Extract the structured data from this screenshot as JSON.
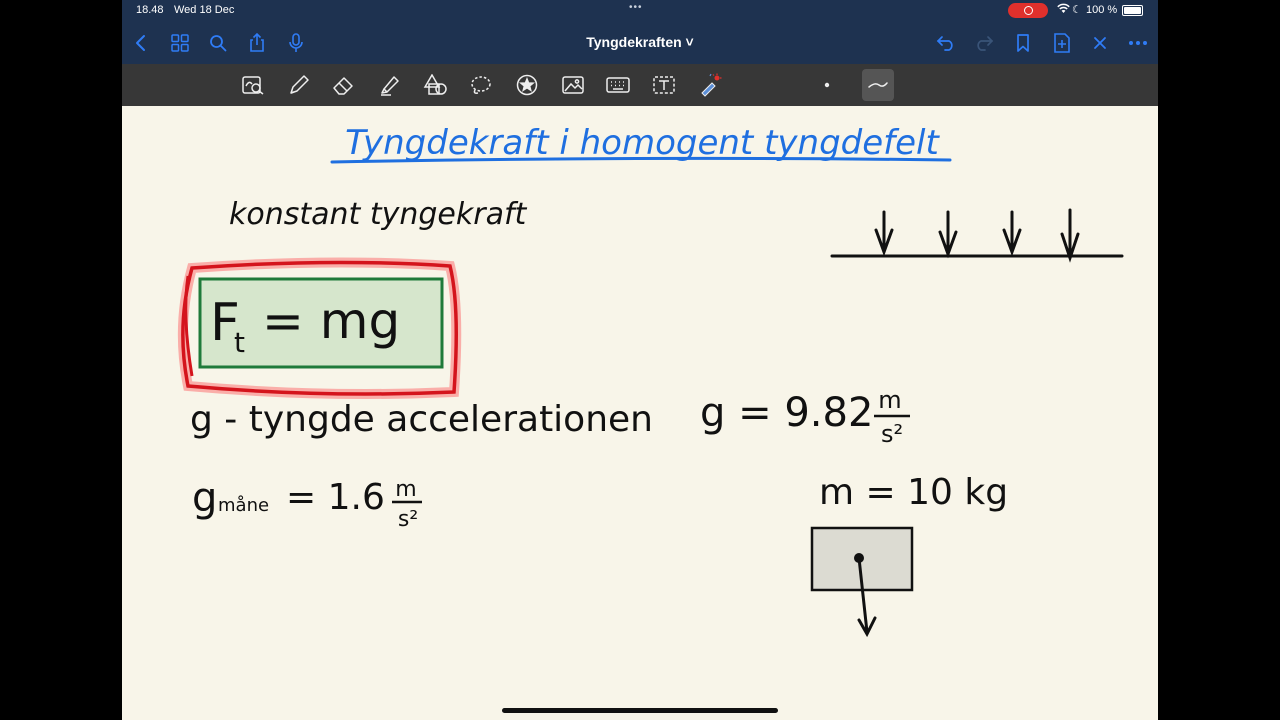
{
  "status_bar": {
    "time": "18.48",
    "date": "Wed 18 Dec",
    "battery": "100 %"
  },
  "nav_bar": {
    "title": "Tyngdekraften",
    "accent_color": "#2f7cf6",
    "left_icons": [
      "back-chevron-icon",
      "grid-icon",
      "search-icon",
      "share-icon",
      "microphone-icon"
    ],
    "right_icons": [
      "undo-icon",
      "redo-icon",
      "bookmark-icon",
      "add-page-icon",
      "close-icon",
      "more-icon"
    ]
  },
  "toolbar": {
    "tools": [
      "zoom-window-icon",
      "pen-icon",
      "eraser-icon",
      "highlighter-icon",
      "shapes-icon",
      "lasso-icon",
      "sticker-icon",
      "image-icon",
      "keyboard-icon",
      "text-box-icon",
      "laser-pointer-icon"
    ],
    "selected_stroke": "curve"
  },
  "note": {
    "heading": "Tyngdekraft i homogent tyngdefelt",
    "heading_color": "#1f6fe0",
    "line1": "konstant tyngekraft",
    "formula_main": "F",
    "formula_sub": "t",
    "formula_rest": "= mg",
    "formula_box_color": "#d6e6cc",
    "highlight_color": "#e01b24",
    "definition": "g - tyngde accelerationen",
    "g_value": "g = 9.82",
    "g_unit_num": "m",
    "g_unit_den": "s²",
    "gmoon_g": "g",
    "gmoon_sub": "måne",
    "gmoon_value": "= 1.6",
    "gmoon_unit_num": "m",
    "gmoon_unit_den": "s²",
    "mass_label": "m = 10 kg"
  }
}
